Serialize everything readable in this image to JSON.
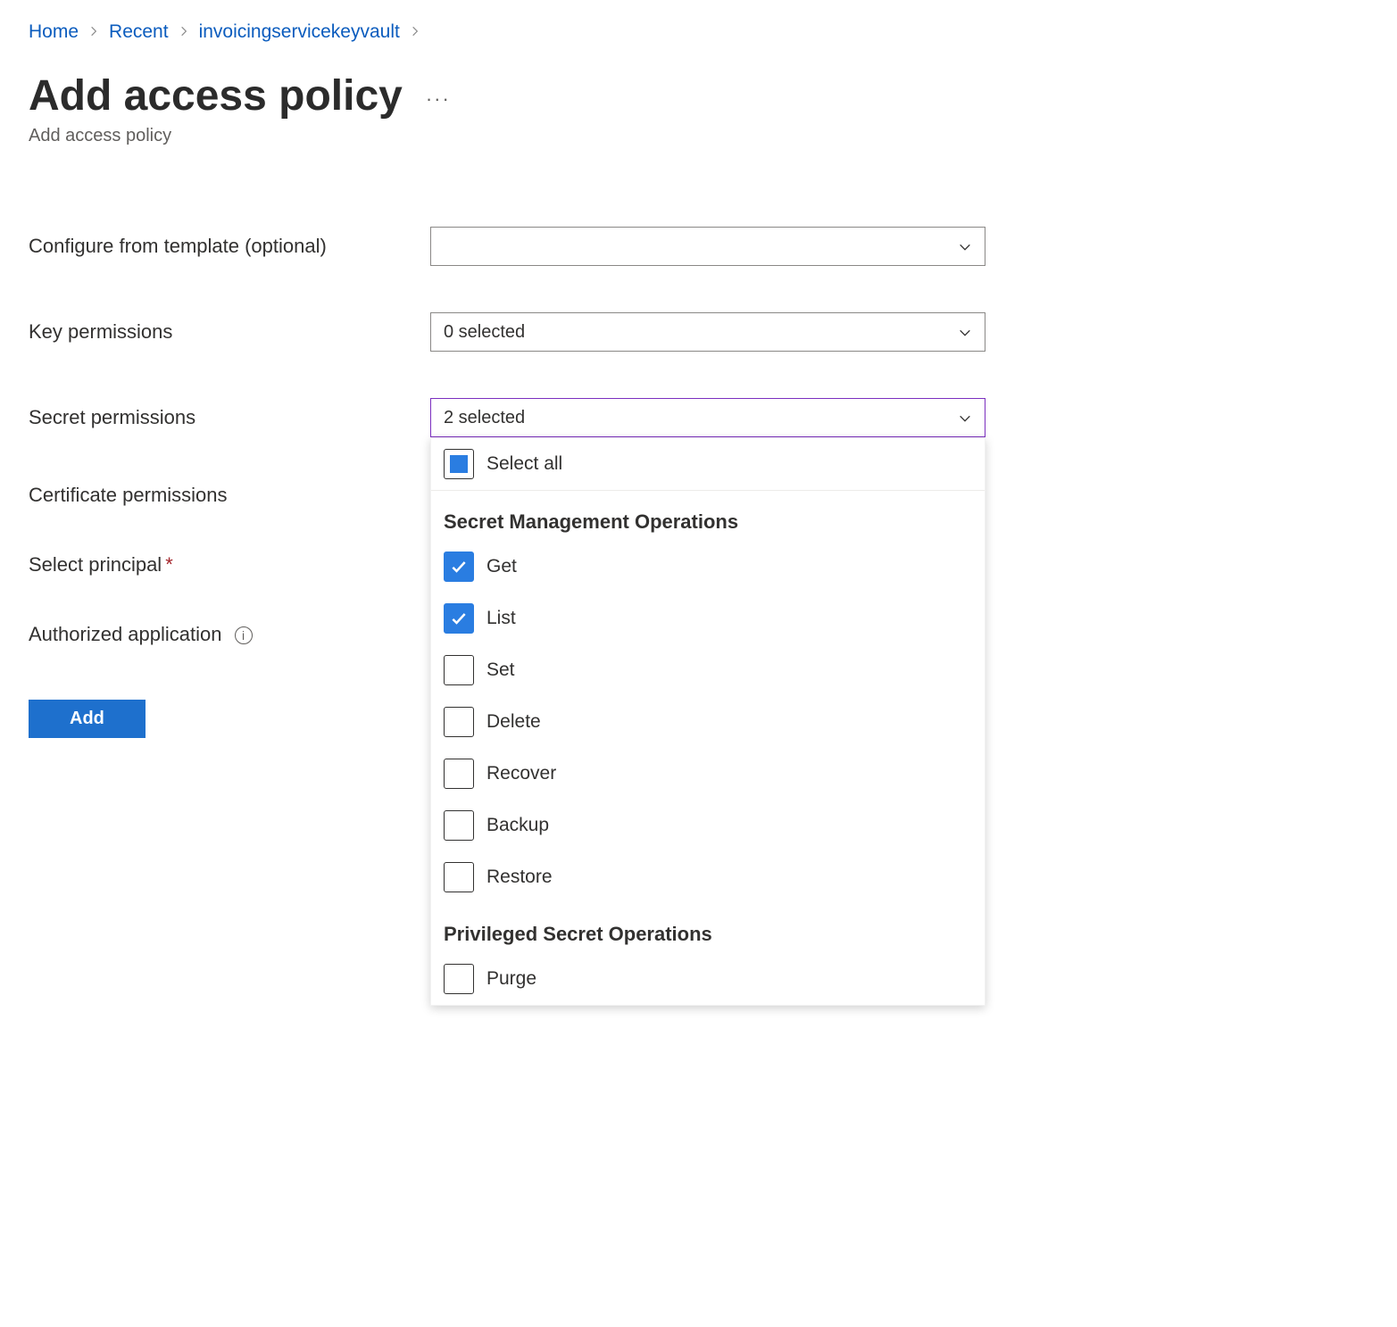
{
  "breadcrumb": [
    {
      "label": "Home"
    },
    {
      "label": "Recent"
    },
    {
      "label": "invoicingservicekeyvault"
    }
  ],
  "header": {
    "title": "Add access policy",
    "subtitle": "Add access policy"
  },
  "form": {
    "template_label": "Configure from template (optional)",
    "template_value": "",
    "key_perm_label": "Key permissions",
    "key_perm_value": "0 selected",
    "secret_perm_label": "Secret permissions",
    "secret_perm_value": "2 selected",
    "cert_perm_label": "Certificate permissions",
    "principal_label": "Select principal",
    "authapp_label": "Authorized application",
    "add_button": "Add"
  },
  "dropdown": {
    "select_all_label": "Select all",
    "sections": [
      {
        "title": "Secret Management Operations",
        "options": [
          {
            "label": "Get",
            "checked": true
          },
          {
            "label": "List",
            "checked": true
          },
          {
            "label": "Set",
            "checked": false
          },
          {
            "label": "Delete",
            "checked": false
          },
          {
            "label": "Recover",
            "checked": false
          },
          {
            "label": "Backup",
            "checked": false
          },
          {
            "label": "Restore",
            "checked": false
          }
        ]
      },
      {
        "title": "Privileged Secret Operations",
        "options": [
          {
            "label": "Purge",
            "checked": false
          }
        ]
      }
    ]
  },
  "colors": {
    "accent": "#2a7de1",
    "focus": "#7b2fbf",
    "link": "#0b5cbe"
  }
}
